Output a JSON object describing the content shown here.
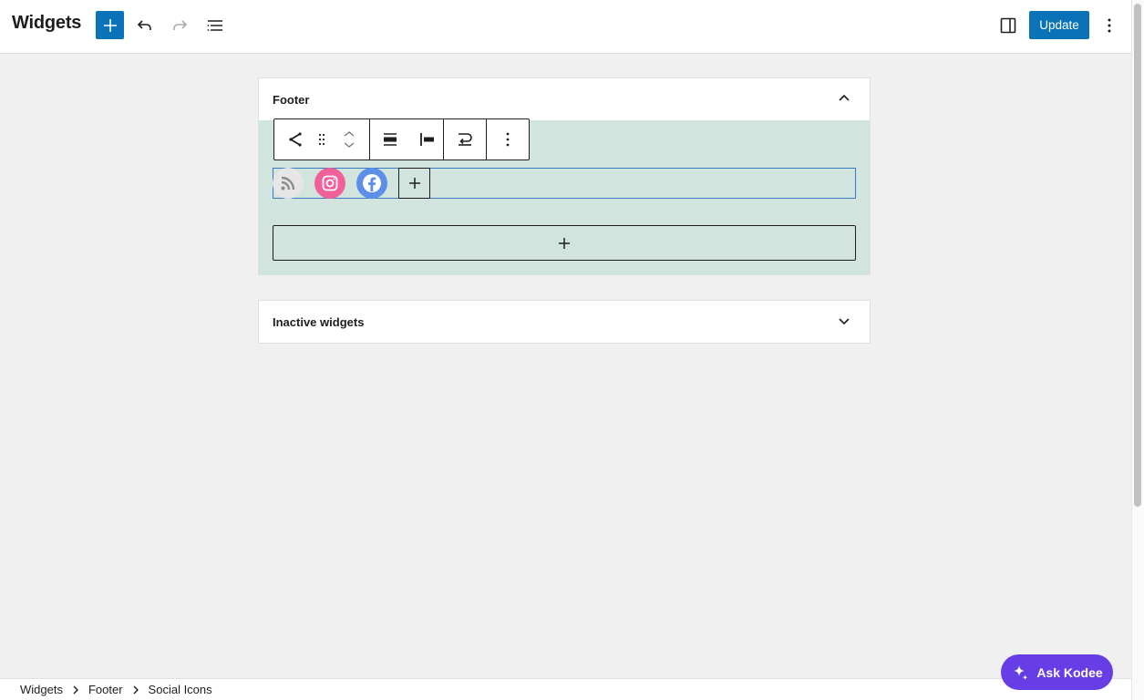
{
  "header": {
    "title": "Widgets",
    "update_label": "Update"
  },
  "footer_area": {
    "title": "Footer",
    "social_icons": [
      {
        "name": "rss-icon",
        "color": "#e6e6e6"
      },
      {
        "name": "instagram-icon",
        "color": "#f0609a"
      },
      {
        "name": "facebook-icon",
        "color": "#5b8fe8"
      }
    ],
    "background_color": "#d1e4dd"
  },
  "inactive_area": {
    "title": "Inactive widgets"
  },
  "breadcrumb": {
    "items": [
      "Widgets",
      "Footer",
      "Social Icons"
    ]
  },
  "kodee": {
    "label": "Ask Kodee"
  },
  "colors": {
    "primary": "#0a73b8",
    "kodee": "#673de6"
  }
}
